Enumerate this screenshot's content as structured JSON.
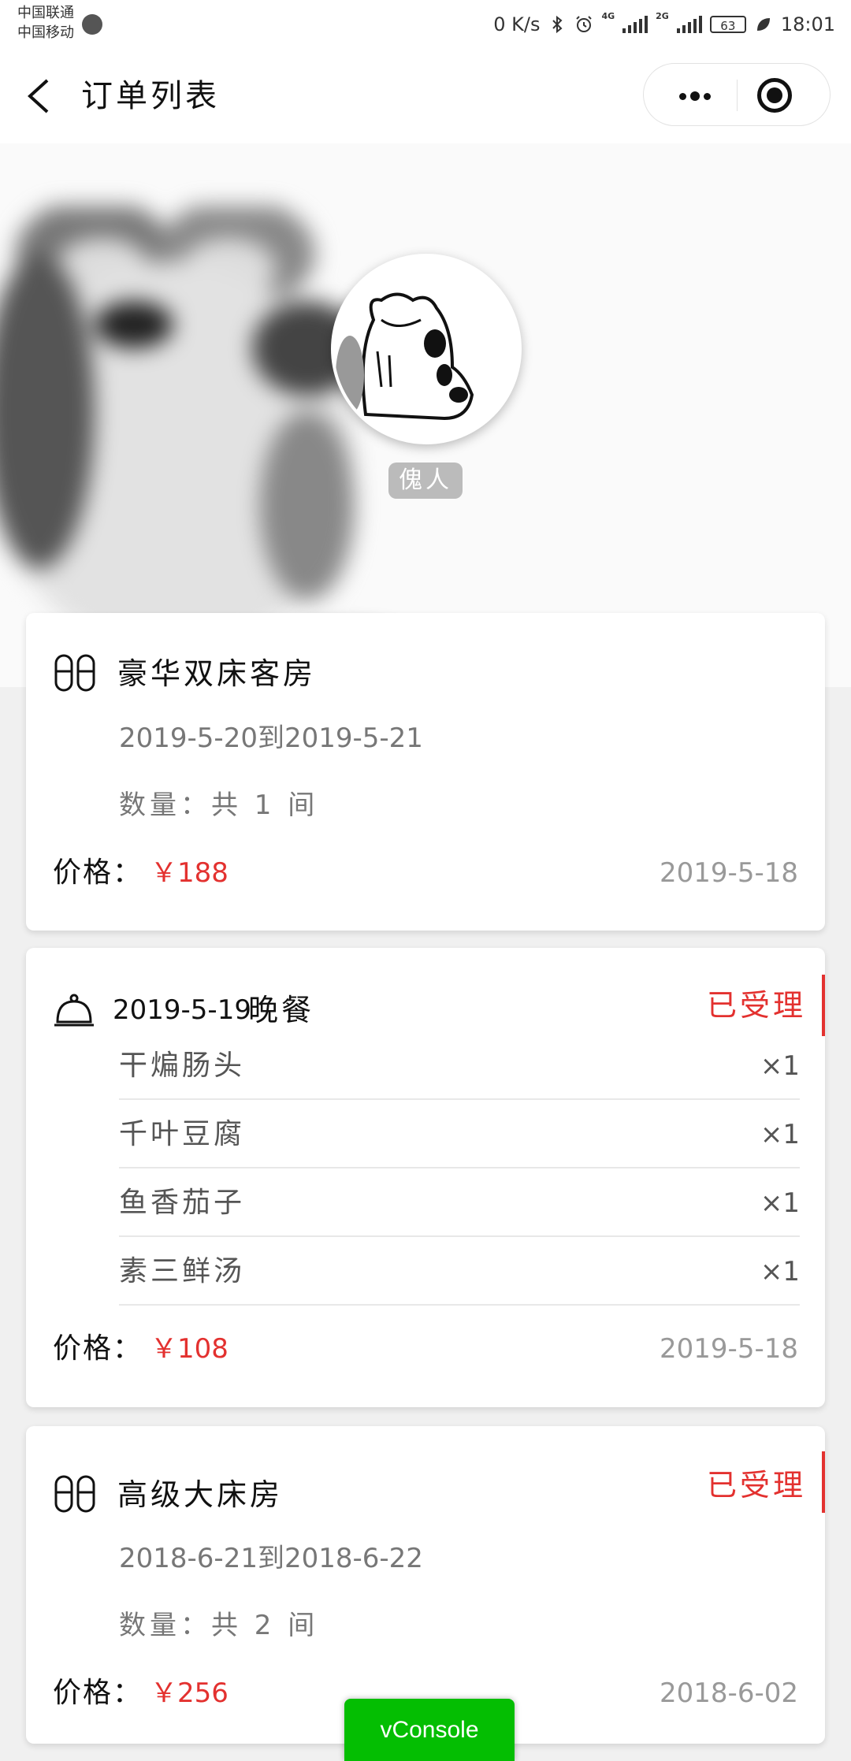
{
  "status_bar": {
    "carrier_1": "中国联通",
    "carrier_2": "中国移动",
    "net_speed": "0 K/s",
    "net_label_1": "4G",
    "net_label_2": "2G",
    "battery": "63",
    "time": "18:01"
  },
  "nav": {
    "title": "订单列表"
  },
  "profile": {
    "nickname": "傀人"
  },
  "orders": [
    {
      "type": "room",
      "title": "豪华双床客房",
      "dates": "2019-5-20到2019-5-21",
      "quantity": "数量：共 1 间",
      "price_label": "价格：",
      "price": "￥188",
      "order_date": "2019-5-18"
    },
    {
      "type": "meal",
      "date": "2019-5-19",
      "meal": "晚餐",
      "status": "已受理",
      "items": [
        {
          "name": "干煸肠头",
          "qty": "×1"
        },
        {
          "name": "千叶豆腐",
          "qty": "×1"
        },
        {
          "name": "鱼香茄子",
          "qty": "×1"
        },
        {
          "name": "素三鲜汤",
          "qty": "×1"
        }
      ],
      "price_label": "价格：",
      "price": "￥108",
      "order_date": "2019-5-18"
    },
    {
      "type": "room",
      "title": "高级大床房",
      "status": "已受理",
      "dates": "2018-6-21到2018-6-22",
      "quantity": "数量：共 2 间",
      "price_label": "价格：",
      "price": "￥256",
      "order_date": "2018-6-02"
    }
  ],
  "vconsole": {
    "label": "vConsole"
  },
  "colors": {
    "accent_red": "#e3312f",
    "vconsole_green": "#04be02"
  }
}
